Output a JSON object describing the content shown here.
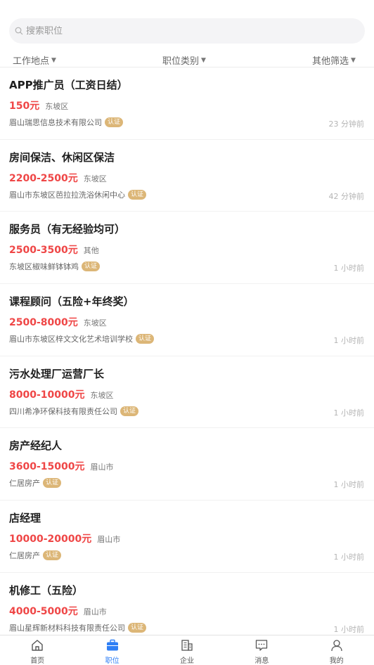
{
  "search": {
    "placeholder": "搜索职位"
  },
  "filters": {
    "location": "工作地点",
    "category": "职位类别",
    "other": "其他筛选"
  },
  "badge_label": "认证",
  "jobs": [
    {
      "title": "APP推广员（工资日结）",
      "salary": "150元",
      "area": "东坡区",
      "company": "眉山瑞思信息技术有限公司",
      "time": "23 分钟前"
    },
    {
      "title": "房间保洁、休闲区保洁",
      "salary": "2200-2500元",
      "area": "东坡区",
      "company": "眉山市东坡区芭拉拉洗浴休闲中心",
      "time": "42 分钟前"
    },
    {
      "title": "服务员（有无经验均可）",
      "salary": "2500-3500元",
      "area": "其他",
      "company": "东坡区椒味鲜钵钵鸡",
      "time": "1 小时前"
    },
    {
      "title": "课程顾问（五险+年终奖）",
      "salary": "2500-8000元",
      "area": "东坡区",
      "company": "眉山市东坡区梓文文化艺术培训学校",
      "time": "1 小时前"
    },
    {
      "title": "污水处理厂运营厂长",
      "salary": "8000-10000元",
      "area": "东坡区",
      "company": "四川希净环保科技有限责任公司",
      "time": "1 小时前"
    },
    {
      "title": "房产经纪人",
      "salary": "3600-15000元",
      "area": "眉山市",
      "company": "仁居房产",
      "time": "1 小时前"
    },
    {
      "title": "店经理",
      "salary": "10000-20000元",
      "area": "眉山市",
      "company": "仁居房产",
      "time": "1 小时前"
    },
    {
      "title": "机修工（五险）",
      "salary": "4000-5000元",
      "area": "眉山市",
      "company": "眉山星辉新材料科技有限责任公司",
      "time": "1 小时前"
    }
  ],
  "tabs": [
    {
      "label": "首页",
      "icon": "home-icon"
    },
    {
      "label": "职位",
      "icon": "briefcase-icon"
    },
    {
      "label": "企业",
      "icon": "building-icon"
    },
    {
      "label": "消息",
      "icon": "chat-icon"
    },
    {
      "label": "我的",
      "icon": "user-icon"
    }
  ],
  "colors": {
    "accent": "#2f7ff5",
    "salary": "#ef4646",
    "badge": "#dcb677"
  }
}
